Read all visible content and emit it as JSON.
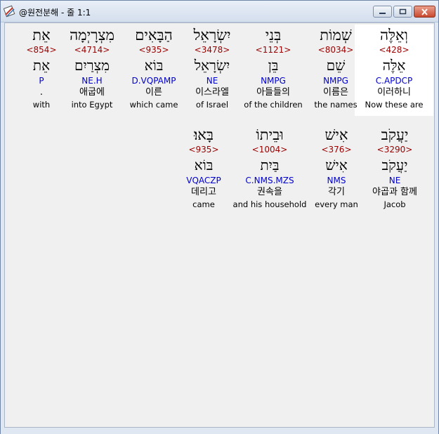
{
  "window": {
    "title": "@원전분해 - 줄 1:1",
    "buttons": {
      "minimize": "▭",
      "maximize": "□",
      "close": "✕"
    }
  },
  "colors": {
    "strong": "#990000",
    "parse": "#0000cc",
    "selected_bg": "#ffffff",
    "client_bg": "#f0f0f0"
  },
  "icons": [
    "app-icon",
    "minimize-icon",
    "maximize-icon",
    "close-icon"
  ],
  "rows": [
    {
      "words": [
        {
          "heb": "וְאֵלֶּה",
          "strong": "<428>",
          "lemma": "אֵלֶּה",
          "parse": "C.APDCP",
          "kor": "이러하니",
          "eng": "Now these are",
          "selected": true
        },
        {
          "heb": "שְׁמוֹת",
          "strong": "<8034>",
          "lemma": "שֵׁם",
          "parse": "NMPG",
          "kor": "이름은",
          "eng": "the names"
        },
        {
          "heb": "בְּנֵי",
          "strong": "<1121>",
          "lemma": "בֵּן",
          "parse": "NMPG",
          "kor": "아들들의",
          "eng": "of the children"
        },
        {
          "heb": "יִשְׂרָאֵל",
          "strong": "<3478>",
          "lemma": "יִשְׂרָאֵל",
          "parse": "NE",
          "kor": "이스라엘",
          "eng": "of Israel"
        },
        {
          "heb": "הַבָּאִים",
          "strong": "<935>",
          "lemma": "בּוֹא",
          "parse": "D.VQPAMP",
          "kor": "이른",
          "eng": "which came"
        },
        {
          "heb": "מִצְרָיְמָה",
          "strong": "<4714>",
          "lemma": "מִצְרַיִם",
          "parse": "NE.H",
          "kor": "애굽에",
          "eng": "into Egypt"
        },
        {
          "heb": "אֵת",
          "strong": "<854>",
          "lemma": "אֵת",
          "parse": "P",
          "kor": ".",
          "eng": "with"
        }
      ]
    },
    {
      "words": [
        {
          "heb": "יַעֲקֹב",
          "strong": "<3290>",
          "lemma": "יַעֲקֹב",
          "parse": "NE",
          "kor": "야곱과 함께",
          "eng": "Jacob"
        },
        {
          "heb": "אִישׁ",
          "strong": "<376>",
          "lemma": "אִישׁ",
          "parse": "NMS",
          "kor": "각기",
          "eng": "every man"
        },
        {
          "heb": "וּבֵיתוֹ",
          "strong": "<1004>",
          "lemma": "בַּיִת",
          "parse": "C.NMS.MZS",
          "kor": "권속을",
          "eng": "and his household"
        },
        {
          "heb": "בָּאוּ׃",
          "strong": "<935>",
          "lemma": "בּוֹא",
          "parse": "VQACZP",
          "kor": "데리고",
          "eng": "came"
        }
      ]
    }
  ]
}
